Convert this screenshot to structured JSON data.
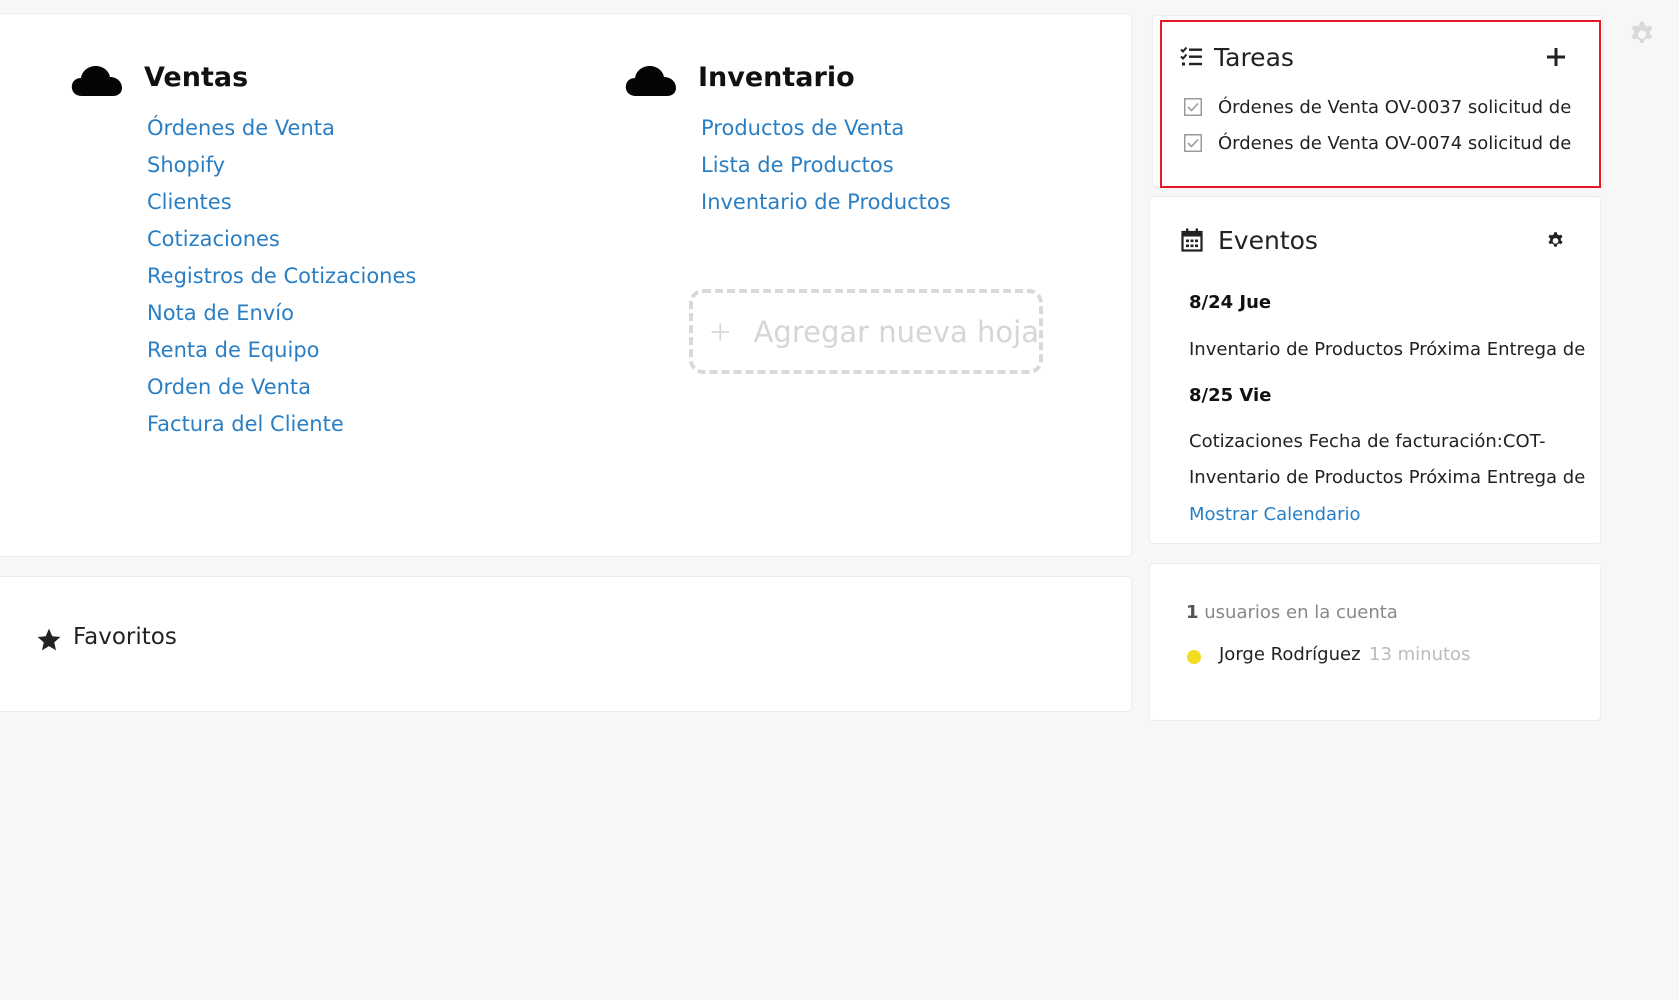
{
  "groups": [
    {
      "title": "Ventas",
      "links": [
        "Órdenes de Venta",
        "Shopify",
        "Clientes",
        "Cotizaciones",
        "Registros de Cotizaciones",
        "Nota de Envío",
        "Renta de Equipo",
        "Orden de Venta",
        "Factura del Cliente"
      ]
    },
    {
      "title": "Inventario",
      "links": [
        "Productos de Venta",
        "Lista de Productos",
        "Inventario de Productos"
      ]
    }
  ],
  "add_sheet": {
    "label": "Agregar nueva hoja"
  },
  "favorites": {
    "title": "Favoritos"
  },
  "tasks": {
    "title": "Tareas",
    "items": [
      {
        "text": "Órdenes de Venta OV-0037 solicitud de",
        "checked": true
      },
      {
        "text": "Órdenes de Venta OV-0074 solicitud de",
        "checked": true
      }
    ]
  },
  "events": {
    "title": "Eventos",
    "days": [
      {
        "date": "8/24 Jue",
        "items": [
          "Inventario de Productos Próxima Entrega de"
        ]
      },
      {
        "date": "8/25 Vie",
        "items": [
          "Cotizaciones Fecha de facturación:COT-",
          "Inventario de Productos Próxima Entrega de"
        ]
      }
    ],
    "show_calendar": "Mostrar Calendario"
  },
  "users": {
    "count": "1",
    "count_label": "usuarios en la cuenta",
    "list": [
      {
        "name": "Jorge Rodríguez",
        "time": "13 minutos",
        "status_color": "#f2dc1f"
      }
    ]
  },
  "colors": {
    "link": "#2a7fc4",
    "highlight": "#e01b24",
    "text": "#222222"
  },
  "icons": {
    "group": "cloud-icon",
    "add": "plus-icon",
    "favorites": "star-icon",
    "tasks": "checklist-icon",
    "events": "calendar-icon",
    "settings": "gear-icon"
  }
}
